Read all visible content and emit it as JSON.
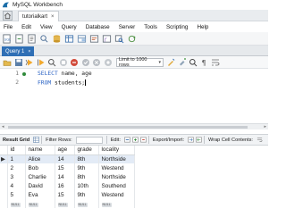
{
  "window": {
    "title": "MySQL Workbench"
  },
  "connection_tab": {
    "label": "tutorialkart",
    "close": "×"
  },
  "menu": [
    "File",
    "Edit",
    "View",
    "Query",
    "Database",
    "Server",
    "Tools",
    "Scripting",
    "Help"
  ],
  "query_tab": {
    "label": "Query 1",
    "close": "×"
  },
  "sql_toolbar": {
    "limit_label": "Limit to 1000 rows"
  },
  "editor": {
    "lines": [
      {
        "number": "1",
        "keyword": "SELECT",
        "rest": " name, age"
      },
      {
        "number": "2",
        "keyword": "FROM",
        "rest": " students;"
      }
    ]
  },
  "result_toolbar": {
    "result_grid": "Result Grid",
    "filter_rows": "Filter Rows:",
    "edit": "Edit:",
    "export_import": "Export/Import:",
    "wrap": "Wrap Cell Contents:"
  },
  "results": {
    "columns": [
      "id",
      "name",
      "age",
      "grade",
      "locality"
    ],
    "rows": [
      [
        "1",
        "Alice",
        "14",
        "8th",
        "Northside"
      ],
      [
        "2",
        "Bob",
        "15",
        "9th",
        "Westend"
      ],
      [
        "3",
        "Charlie",
        "14",
        "8th",
        "Northside"
      ],
      [
        "4",
        "David",
        "16",
        "10th",
        "Southend"
      ],
      [
        "5",
        "Eva",
        "15",
        "9th",
        "Westend"
      ]
    ],
    "null_label": "NULL",
    "selected_row_marker": "▶"
  },
  "colors": {
    "keyword": "#2b63c4",
    "query_tab_active": "#2f6fb5",
    "line_marker": "#2f8a3a",
    "selected_row": "#e3ebf6"
  }
}
